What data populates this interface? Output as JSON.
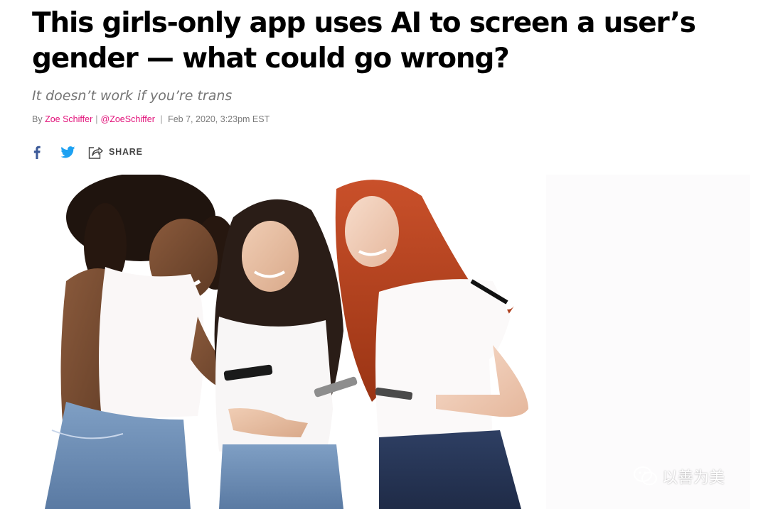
{
  "article": {
    "headline": "This girls-only app uses AI to screen a user’s gender — what could go wrong?",
    "dek": "It doesn’t work if you’re trans",
    "byline": {
      "prefix": "By",
      "author": "Zoe Schiffer",
      "handle": "@ZoeSchiffer",
      "date": "Feb 7, 2020, 3:23pm EST"
    }
  },
  "share": {
    "facebook_icon": "facebook-icon",
    "twitter_icon": "twitter-icon",
    "share_icon": "share-icon",
    "share_label": "SHARE"
  },
  "hero_image": {
    "subject": "photo-three-women-phones",
    "watermark_text": "以善为美",
    "watermark_icon": "wechat-icon"
  },
  "colors": {
    "headline": "#000000",
    "dek": "#757575",
    "byline_link": "#e2127a",
    "facebook": "#3b5998",
    "twitter": "#1da1f2"
  }
}
